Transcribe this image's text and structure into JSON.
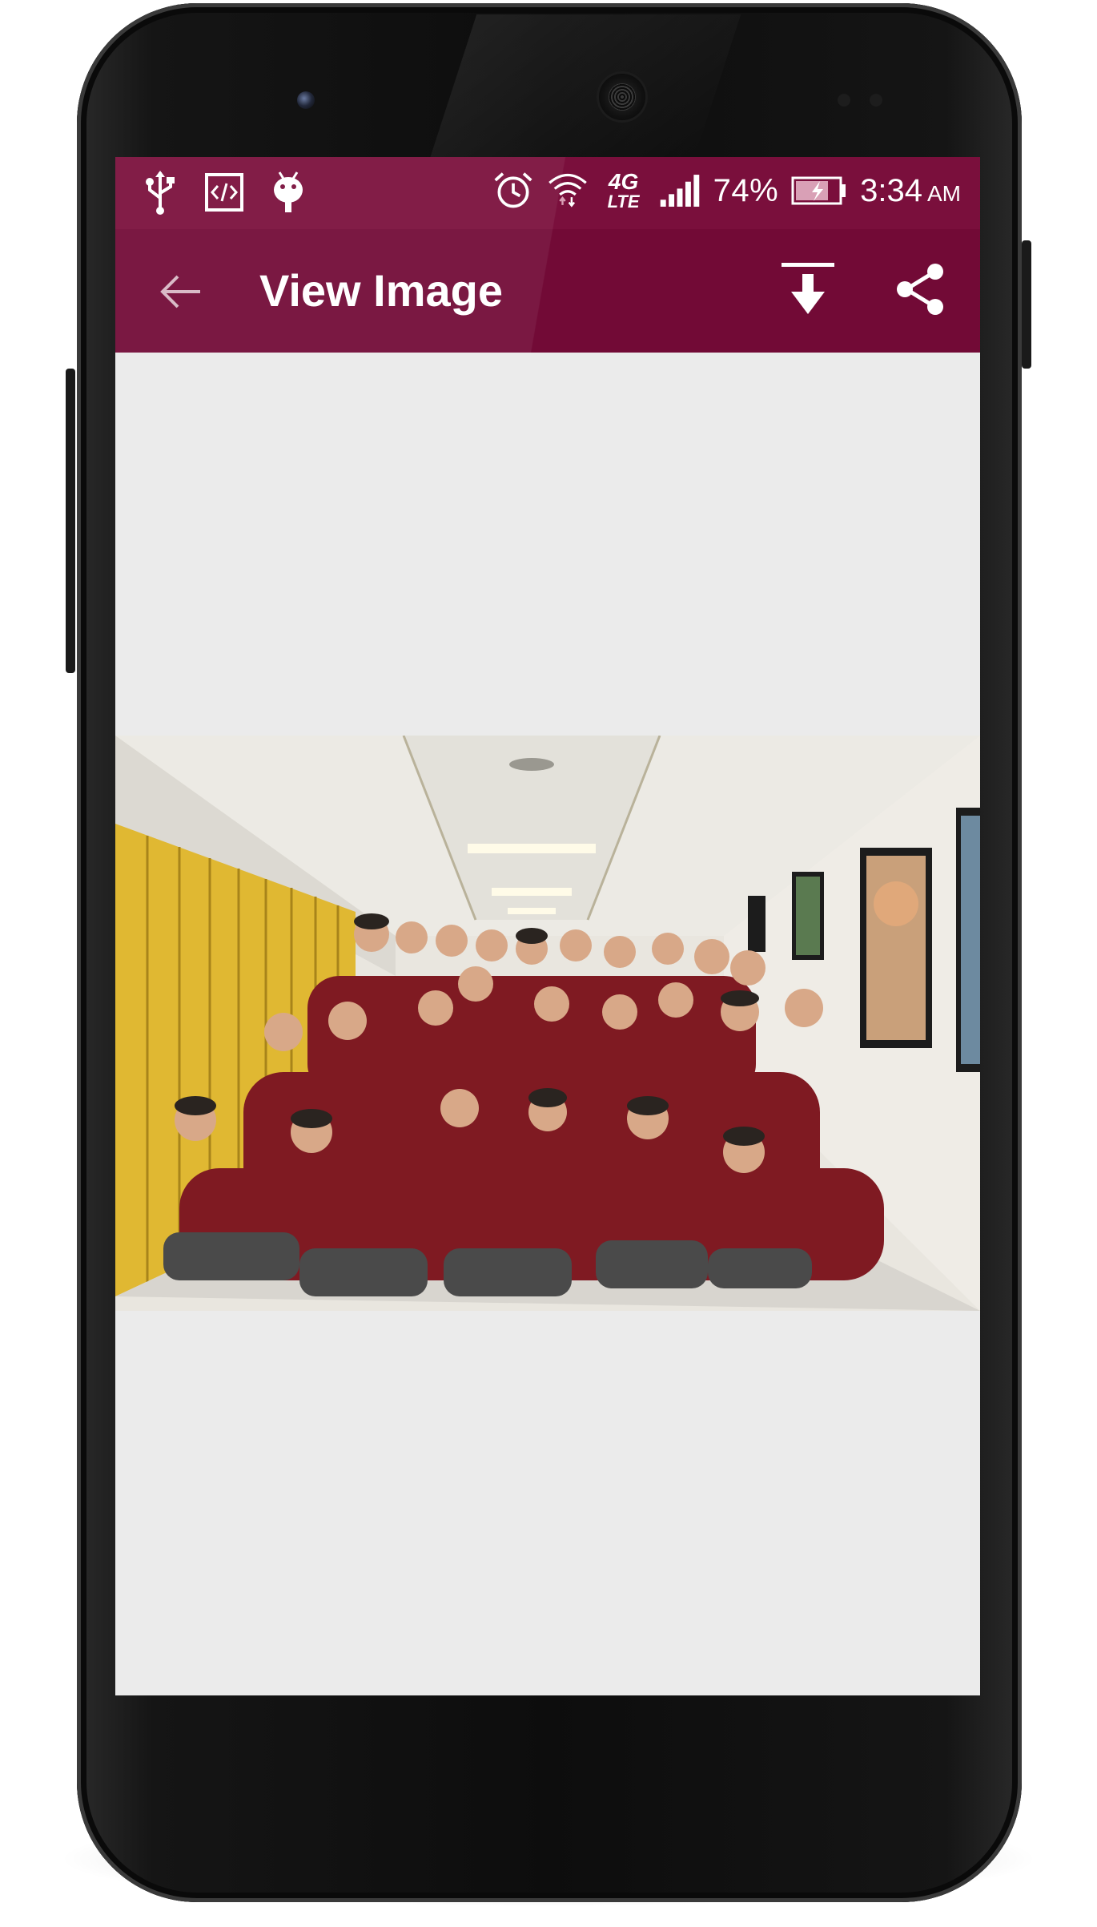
{
  "statusbar": {
    "notification_icons": [
      "usb-icon",
      "code-icon",
      "android-debug-icon"
    ],
    "system_icons": [
      "alarm-icon",
      "wifi-icon",
      "signal-icon",
      "battery-charging-icon"
    ],
    "network_label": "4G",
    "network_sub_label": "LTE",
    "battery_percent": "74%",
    "time": "3:34",
    "ampm": "AM"
  },
  "toolbar": {
    "back_icon": "arrow-left-icon",
    "title": "View Image",
    "download_icon": "download-icon",
    "share_icon": "share-icon"
  },
  "theme": {
    "primary": "#720a36",
    "status_bar": "#7a0f3c",
    "background": "#ebebeb",
    "accent_shirt": "#8b1a24"
  },
  "image": {
    "description_icon": "group-photo"
  }
}
